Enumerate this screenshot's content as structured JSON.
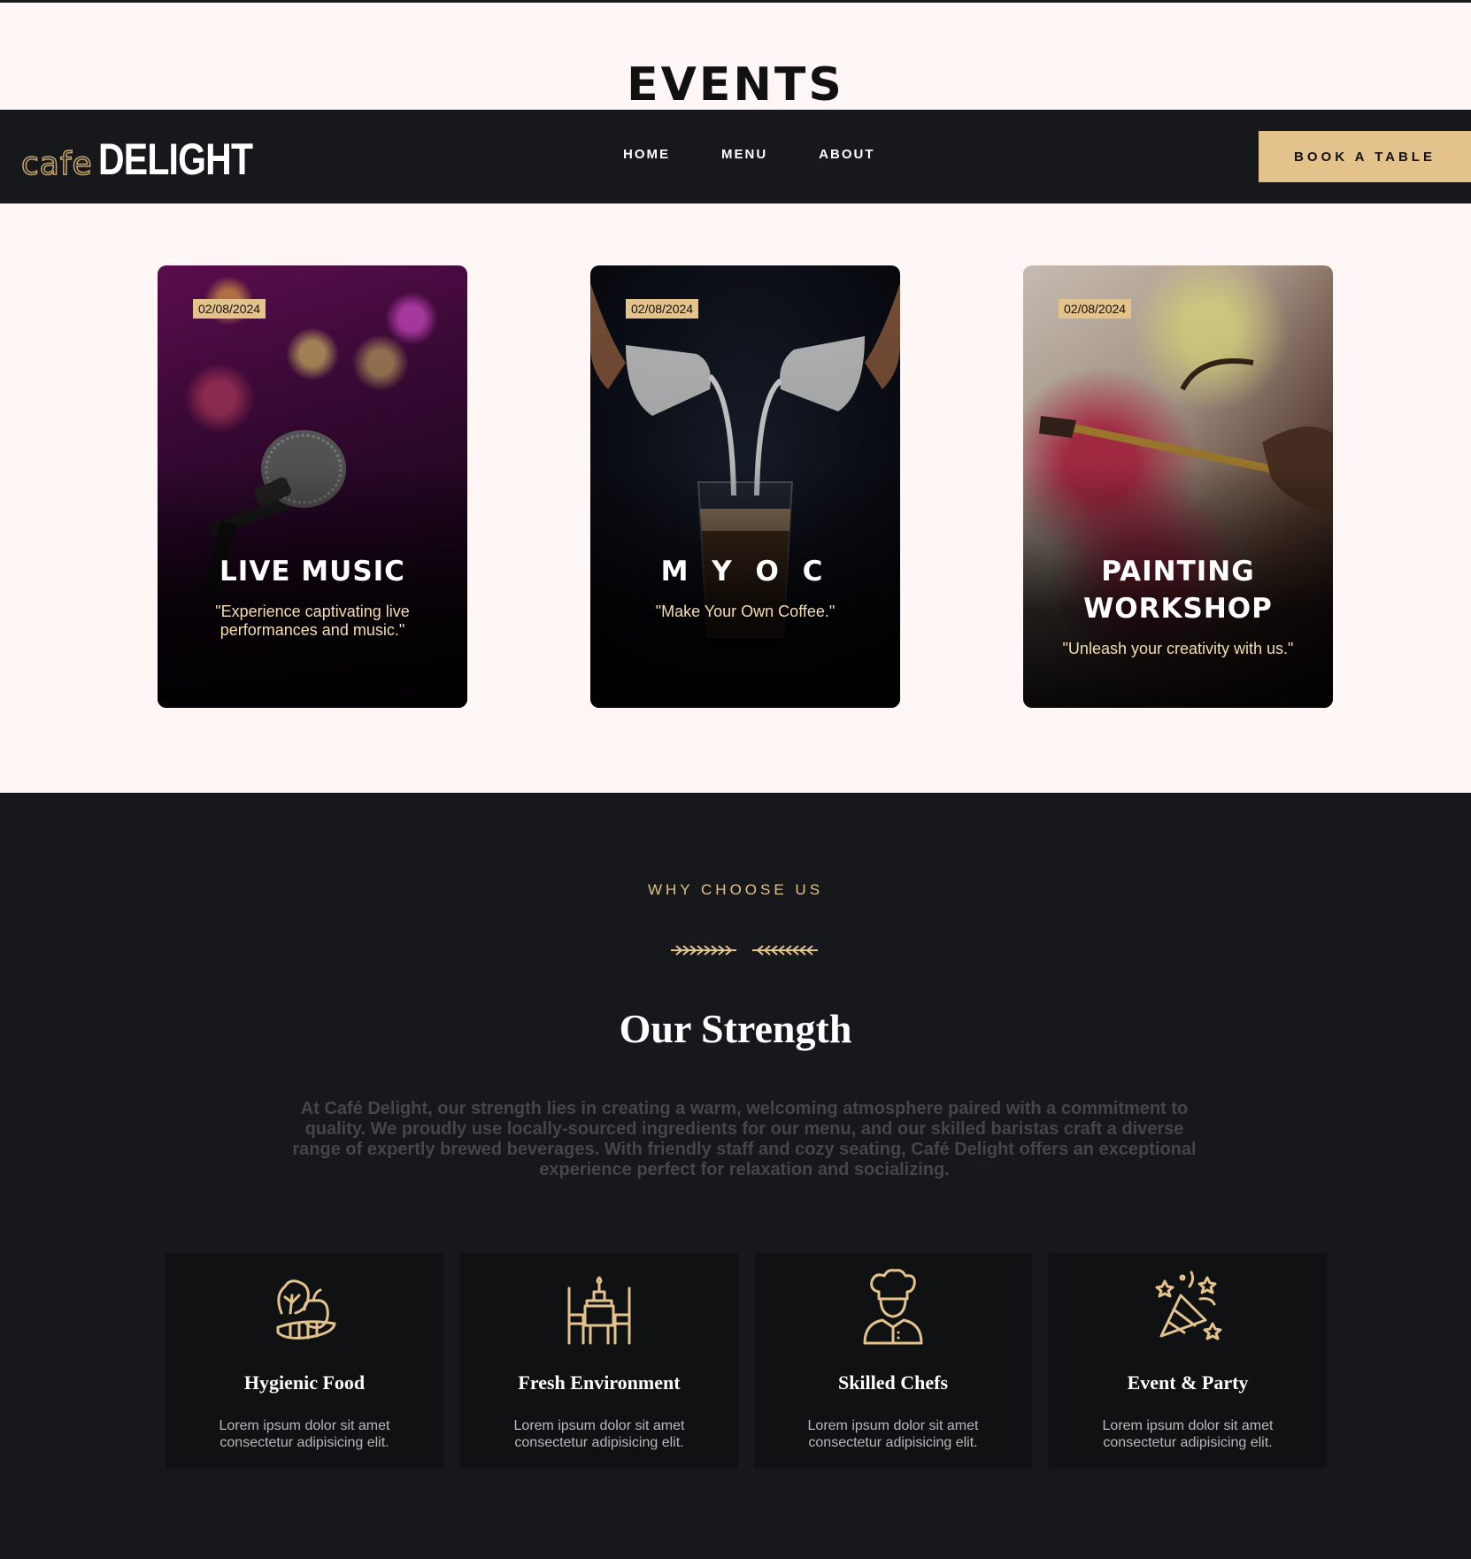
{
  "page": {
    "heading": "EVENTS"
  },
  "navbar": {
    "logo_cafe": "cafe",
    "logo_delight": "DELIGHT",
    "links": [
      "HOME",
      "MENU",
      "ABOUT"
    ],
    "cta": "BOOK A TABLE"
  },
  "events": [
    {
      "date": "02/08/2024",
      "title": "LIVE MUSIC",
      "desc": "\"Experience captivating live performances and music.\""
    },
    {
      "date": "02/08/2024",
      "title": "M Y O C",
      "desc": "\"Make Your Own Coffee.\""
    },
    {
      "date": "02/08/2024",
      "title": "PAINTING WORKSHOP",
      "desc": "\"Unleash your creativity with us.\""
    }
  ],
  "why": {
    "label": "WHY CHOOSE US",
    "title": "Our Strength",
    "text": "At Café Delight, our strength lies in creating a warm, welcoming atmosphere paired with a commitment to quality. We proudly use locally-sourced ingredients for our menu, and our skilled baristas craft a diverse range of expertly brewed beverages. With friendly staff and cozy seating, Café Delight offers an exceptional experience perfect for relaxation and socializing.",
    "features": [
      {
        "icon": "vegetables-icon",
        "title": "Hygienic Food",
        "text": "Lorem ipsum dolor sit amet consectetur adipisicing elit."
      },
      {
        "icon": "dining-table-icon",
        "title": "Fresh Environment",
        "text": "Lorem ipsum dolor sit amet consectetur adipisicing elit."
      },
      {
        "icon": "chef-icon",
        "title": "Skilled Chefs",
        "text": "Lorem ipsum dolor sit amet consectetur adipisicing elit."
      },
      {
        "icon": "party-popper-icon",
        "title": "Event & Party",
        "text": "Lorem ipsum dolor sit amet consectetur adipisicing elit."
      }
    ]
  },
  "colors": {
    "accent": "#e3c28c",
    "dark": "#17181b",
    "light_bg": "#fff6f6"
  }
}
